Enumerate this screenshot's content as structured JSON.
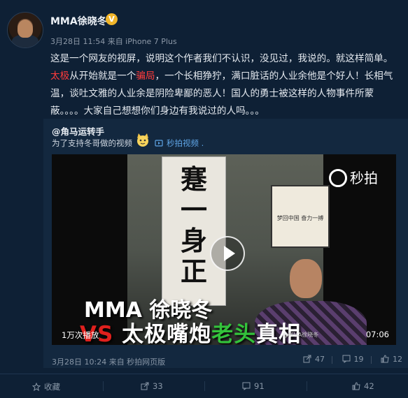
{
  "post": {
    "username": "MMA徐晓冬",
    "verified_icon": "v-badge-icon",
    "meta": "3月28日 11:54 来自 iPhone 7 Plus",
    "text_p1": "这是一个网友的视屏，说明这个作者我们不认识，没见过，我说的。就这样简单。",
    "text_red1": "太极",
    "text_p2": "从开始就是一个",
    "text_red2": "骗局",
    "text_p3": "，一个长相狰狞，满口脏话的人业余他是个好人！长相气温，谈吐文雅的人业余是阴险卑鄙的恶人！国人的勇士被这样的人物事件所蒙蔽。。。。大家自己想想你们身边有我说过的人吗。。。"
  },
  "repost": {
    "username": "@角马运转手",
    "text": "为了支持冬哥做的视频",
    "video_link": "秒拍视频 .",
    "meta": "3月28日 10:24 来自 秒拍网页版",
    "actions": {
      "share": "47",
      "comment": "19",
      "like": "12"
    }
  },
  "video": {
    "logo": "秒拍",
    "calligraphy": "蹇一身正氣",
    "frame_text": "梦回中国 奋力一搏",
    "title_line1": "MMA 徐晓冬",
    "title_vs": "VS",
    "title_part1": " 太极嘴炮",
    "title_green": "老头",
    "title_part2": "真相",
    "watermark": "@MMA徐晓冬",
    "plays": "1万次播放",
    "duration": "07:06"
  },
  "footer": {
    "favorite": "收藏",
    "share": "33",
    "comment": "91",
    "like": "42"
  }
}
